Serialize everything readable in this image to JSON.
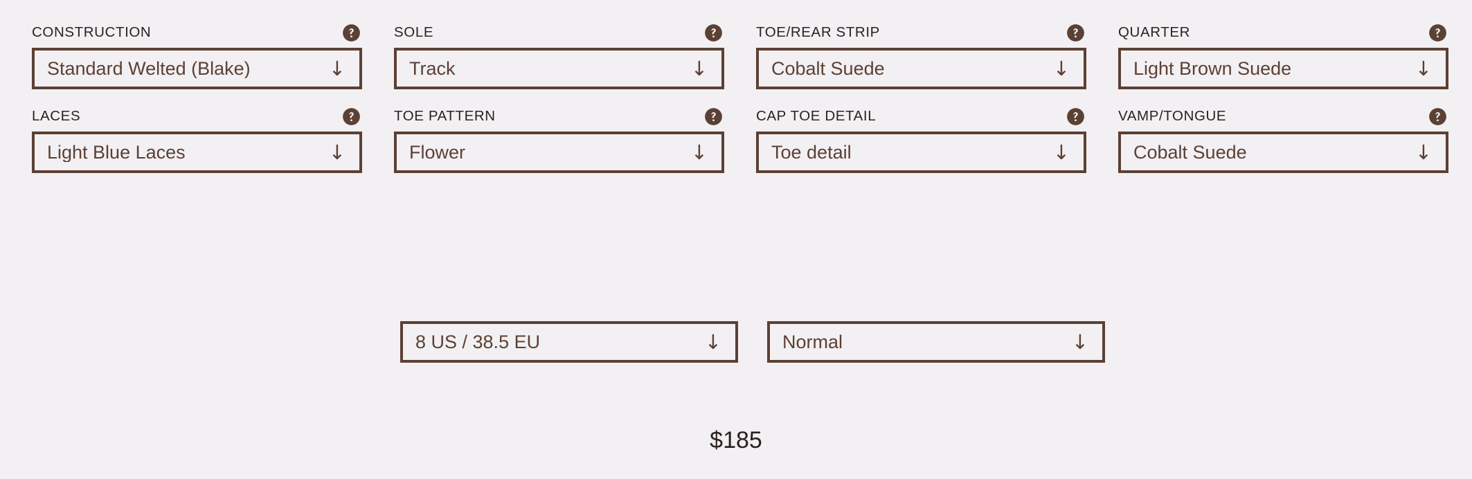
{
  "theme": {
    "background": "#f2f0f2",
    "border_color": "#5b4034",
    "value_text_color": "#5c4035",
    "label_text_color": "#2b2220"
  },
  "icons": {
    "help": "help-circle-icon",
    "dropdown_arrow": "↓"
  },
  "options": [
    {
      "label": "CONSTRUCTION",
      "value": "Standard Welted (Blake)",
      "help": "?",
      "arrow": "↓"
    },
    {
      "label": "SOLE",
      "value": "Track",
      "help": "?",
      "arrow": "↓"
    },
    {
      "label": "TOE/REAR STRIP",
      "value": "Cobalt Suede",
      "help": "?",
      "arrow": "↓"
    },
    {
      "label": "QUARTER",
      "value": "Light Brown Suede",
      "help": "?",
      "arrow": "↓"
    },
    {
      "label": "LACES",
      "value": "Light Blue Laces",
      "help": "?",
      "arrow": "↓"
    },
    {
      "label": "TOE PATTERN",
      "value": "Flower",
      "help": "?",
      "arrow": "↓"
    },
    {
      "label": "CAP TOE DETAIL",
      "value": "Toe detail",
      "help": "?",
      "arrow": "↓"
    },
    {
      "label": "VAMP/TONGUE",
      "value": "Cobalt Suede",
      "help": "?",
      "arrow": "↓"
    }
  ],
  "sizing": {
    "size": {
      "value": "8 US / 38.5 EU",
      "arrow": "↓"
    },
    "width": {
      "value": "Normal",
      "arrow": "↓"
    }
  },
  "price": "$185"
}
